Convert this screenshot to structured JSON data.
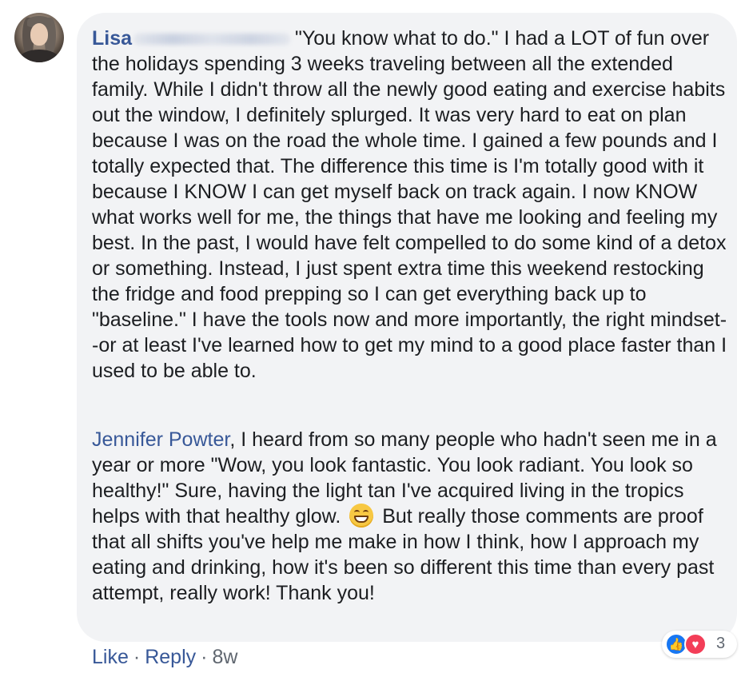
{
  "comment": {
    "author_first": "Lisa",
    "body": "\"You know what to do.\" I had a LOT of fun over the holidays spending 3 weeks traveling between all the extended family. While I didn't throw all the newly good eating and exercise habits out the window, I definitely splurged. It was very hard to eat on plan because I was on the road the whole time. I gained a few pounds and I totally expected that. The difference this time is I'm totally good with it because I KNOW I can get myself back on track again. I now KNOW what works well for me, the things that have me looking and feeling my best. In the past, I would have felt compelled to do some kind of a detox or something. Instead, I just spent extra time this weekend restocking the fridge and food prepping so I can get everything back up to \"baseline.\" I have the tools now and more importantly, the right mindset--or at least I've learned how to get my mind to a good place faster than I used to be able to.",
    "mention": "Jennifer Powter",
    "para2_a": ", I heard from so many people who hadn't seen me in a year or more \"Wow, you look fantastic. You look radiant. You look so healthy!\" Sure, having the light tan I've acquired living in the tropics helps with that healthy glow.",
    "para2_b": " But really those comments are proof that all shifts you've help me make in how I think, how I approach my eating and drinking, how it's been so different this time than every past attempt, really work! Thank you!"
  },
  "reactions": {
    "count": "3",
    "like_icon": "thumbs-up-icon",
    "love_icon": "heart-icon"
  },
  "actions": {
    "like": "Like",
    "reply": "Reply",
    "separator": "·",
    "age": "8w"
  },
  "colors": {
    "bubble": "#f2f3f5",
    "link": "#385898",
    "text": "#1c1e21",
    "meta": "#606770",
    "like": "#1877f2",
    "love": "#f33e58"
  }
}
